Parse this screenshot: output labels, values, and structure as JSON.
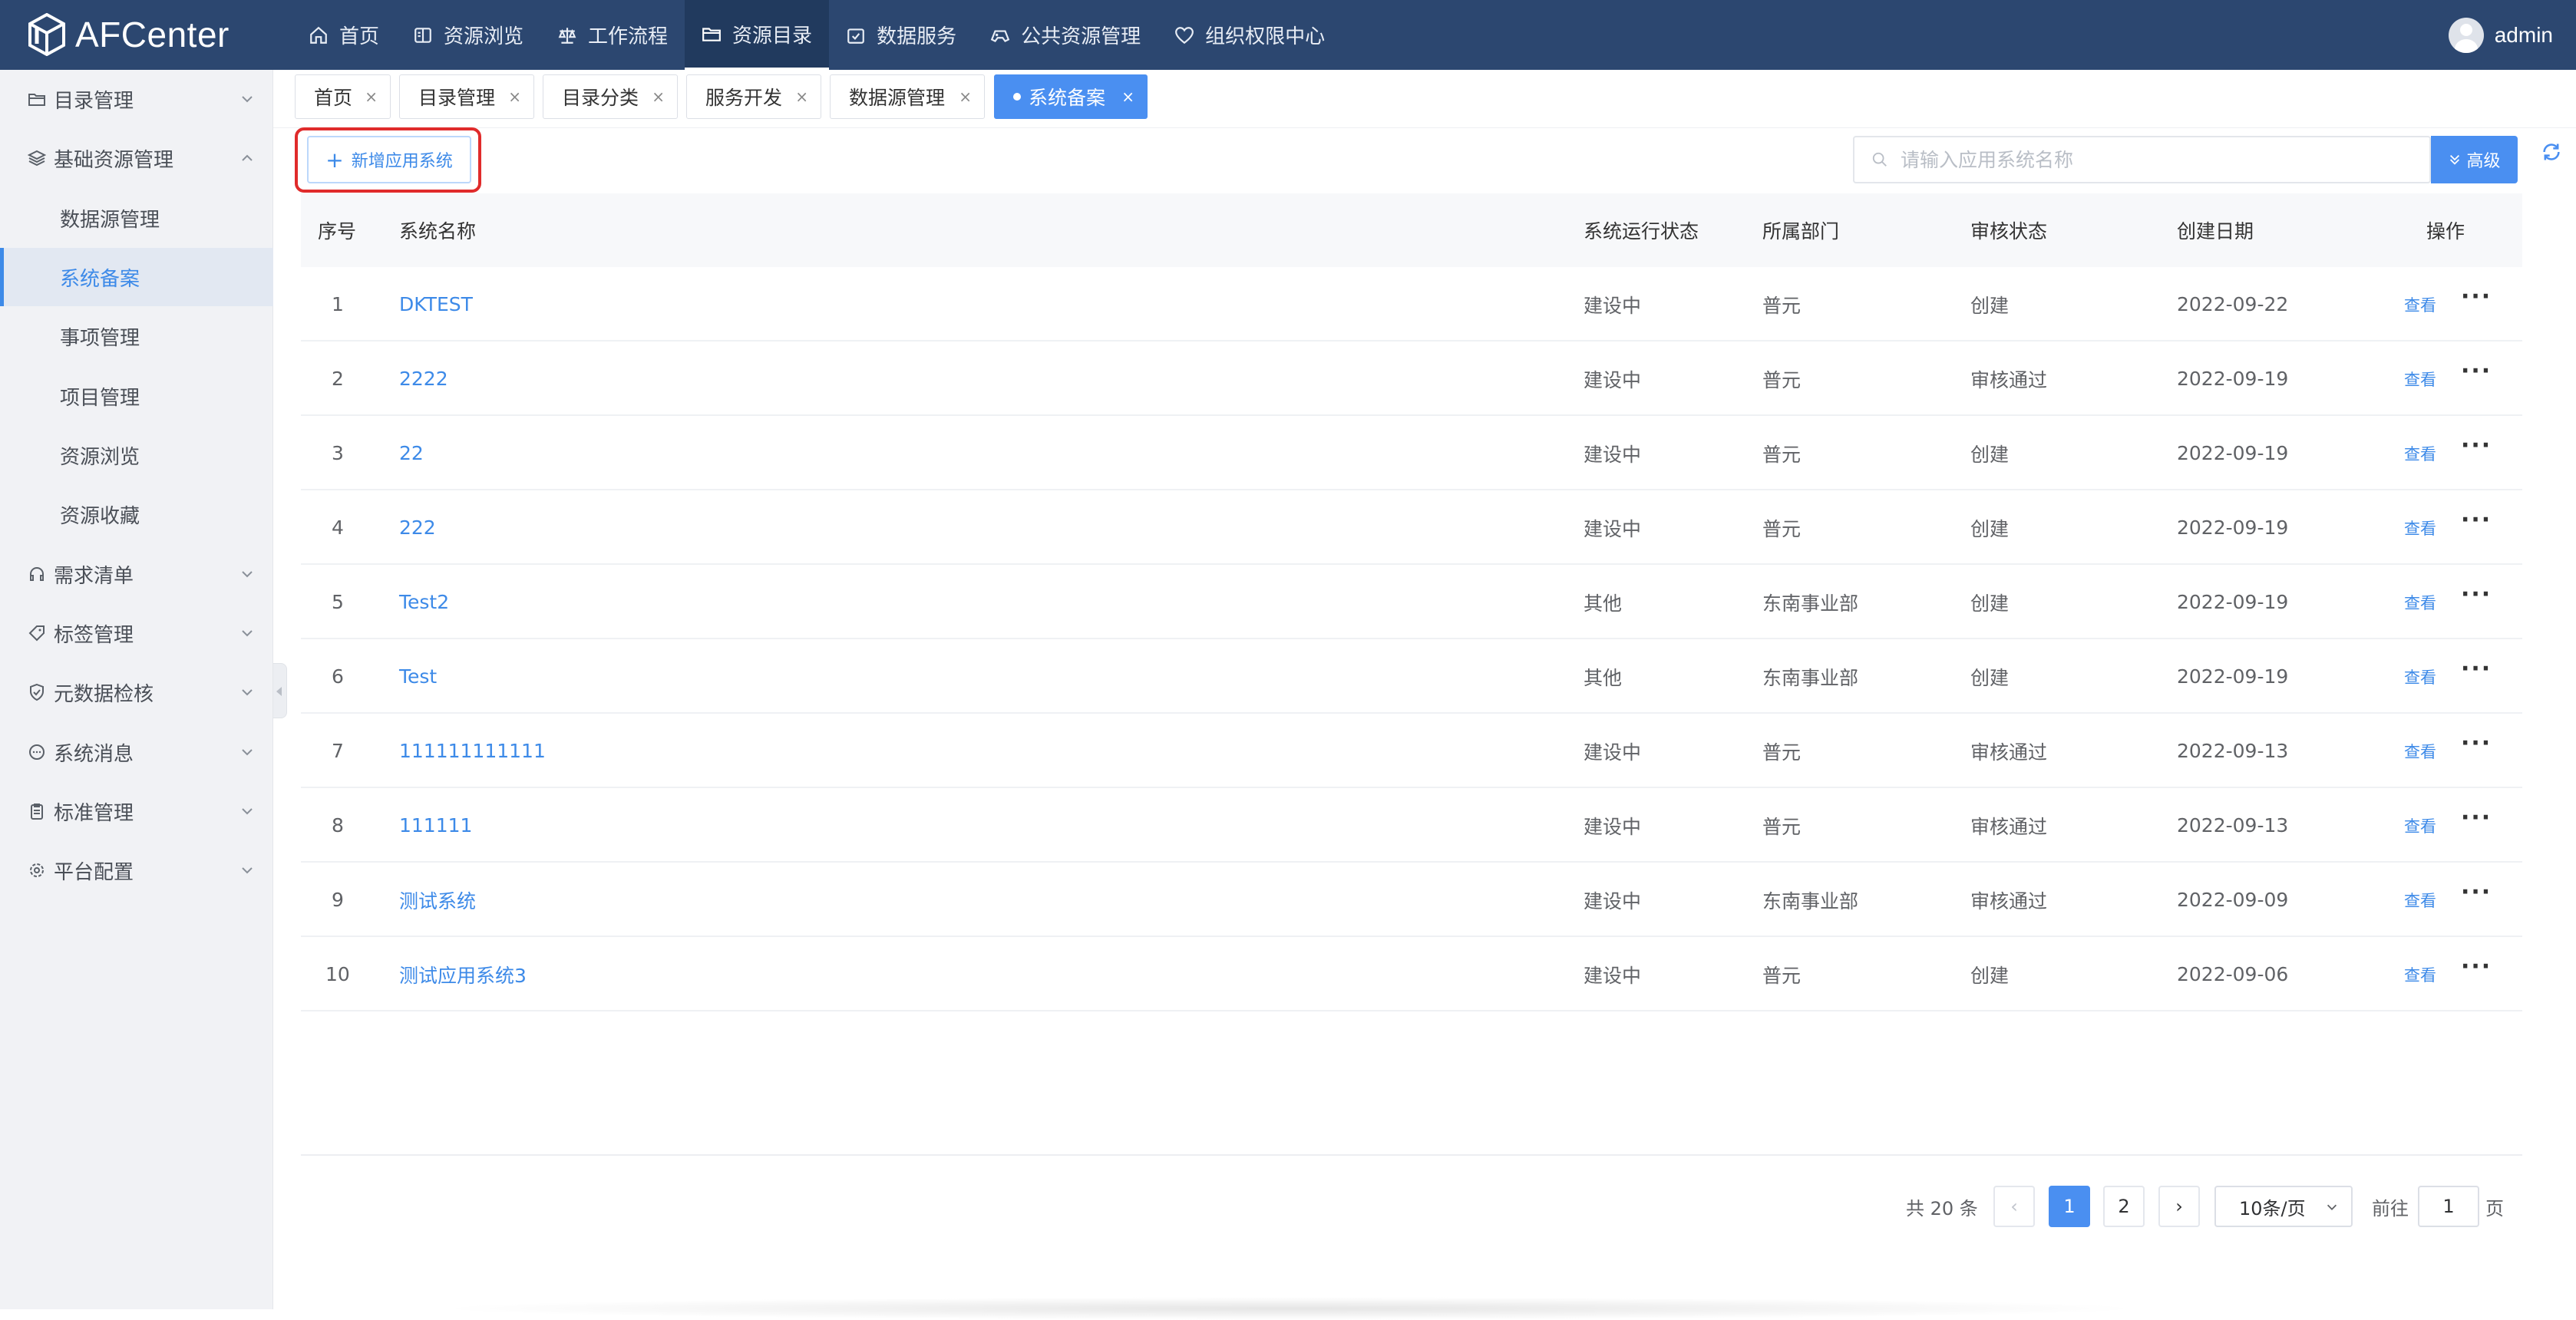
{
  "app": {
    "name": "AFCenter"
  },
  "topnav": [
    {
      "label": "首页",
      "icon": "home-icon"
    },
    {
      "label": "资源浏览",
      "icon": "book-icon"
    },
    {
      "label": "工作流程",
      "icon": "scale-icon"
    },
    {
      "label": "资源目录",
      "icon": "folder-icon",
      "active": true
    },
    {
      "label": "数据服务",
      "icon": "calendar-check-icon"
    },
    {
      "label": "公共资源管理",
      "icon": "gamepad-icon"
    },
    {
      "label": "组织权限中心",
      "icon": "heart-shield-icon"
    }
  ],
  "user": {
    "name": "admin"
  },
  "sidebar": {
    "groups": [
      {
        "label": "目录管理",
        "icon": "folder-icon"
      },
      {
        "label": "基础资源管理",
        "icon": "layers-icon",
        "expanded": true
      },
      {
        "label": "需求清单",
        "icon": "headset-icon"
      },
      {
        "label": "标签管理",
        "icon": "tag-icon"
      },
      {
        "label": "元数据检核",
        "icon": "shield-check-icon"
      },
      {
        "label": "系统消息",
        "icon": "chat-icon"
      },
      {
        "label": "标准管理",
        "icon": "clipboard-icon"
      },
      {
        "label": "平台配置",
        "icon": "gear-icon"
      }
    ],
    "sub_items": [
      {
        "label": "数据源管理"
      },
      {
        "label": "系统备案",
        "active": true
      },
      {
        "label": "事项管理"
      },
      {
        "label": "项目管理"
      },
      {
        "label": "资源浏览"
      },
      {
        "label": "资源收藏"
      }
    ]
  },
  "tabs": [
    {
      "label": "首页"
    },
    {
      "label": "目录管理"
    },
    {
      "label": "目录分类"
    },
    {
      "label": "服务开发"
    },
    {
      "label": "数据源管理"
    },
    {
      "label": "系统备案",
      "active": true
    }
  ],
  "toolbar": {
    "add_label": "新增应用系统",
    "search_placeholder": "请输入应用系统名称",
    "advanced_label": "高级"
  },
  "table": {
    "columns": [
      "序号",
      "系统名称",
      "系统运行状态",
      "所属部门",
      "审核状态",
      "创建日期",
      "操作"
    ],
    "view_label": "查看",
    "more_label": "···",
    "rows": [
      {
        "no": "1",
        "name": "DKTEST",
        "status": "建设中",
        "dept": "普元",
        "audit": "创建",
        "date": "2022-09-22"
      },
      {
        "no": "2",
        "name": "2222",
        "status": "建设中",
        "dept": "普元",
        "audit": "审核通过",
        "date": "2022-09-19"
      },
      {
        "no": "3",
        "name": "22",
        "status": "建设中",
        "dept": "普元",
        "audit": "创建",
        "date": "2022-09-19"
      },
      {
        "no": "4",
        "name": "222",
        "status": "建设中",
        "dept": "普元",
        "audit": "创建",
        "date": "2022-09-19"
      },
      {
        "no": "5",
        "name": "Test2",
        "status": "其他",
        "dept": "东南事业部",
        "audit": "创建",
        "date": "2022-09-19"
      },
      {
        "no": "6",
        "name": "Test",
        "status": "其他",
        "dept": "东南事业部",
        "audit": "创建",
        "date": "2022-09-19"
      },
      {
        "no": "7",
        "name": "111111111111",
        "status": "建设中",
        "dept": "普元",
        "audit": "审核通过",
        "date": "2022-09-13"
      },
      {
        "no": "8",
        "name": "111111",
        "status": "建设中",
        "dept": "普元",
        "audit": "审核通过",
        "date": "2022-09-13"
      },
      {
        "no": "9",
        "name": "测试系统",
        "status": "建设中",
        "dept": "东南事业部",
        "audit": "审核通过",
        "date": "2022-09-09"
      },
      {
        "no": "10",
        "name": "测试应用系统3",
        "status": "建设中",
        "dept": "普元",
        "audit": "创建",
        "date": "2022-09-06"
      }
    ]
  },
  "pagination": {
    "total_label": "共 20 条",
    "prev": "‹",
    "next": "›",
    "pages": [
      "1",
      "2"
    ],
    "current": "1",
    "page_size": "10条/页",
    "goto_prefix": "前往",
    "goto_value": "1",
    "goto_suffix": "页"
  },
  "colors": {
    "topbar": "#2c4770",
    "accent": "#4a8ff1",
    "link": "#3d8ae8",
    "highlight": "#e02b2b"
  }
}
